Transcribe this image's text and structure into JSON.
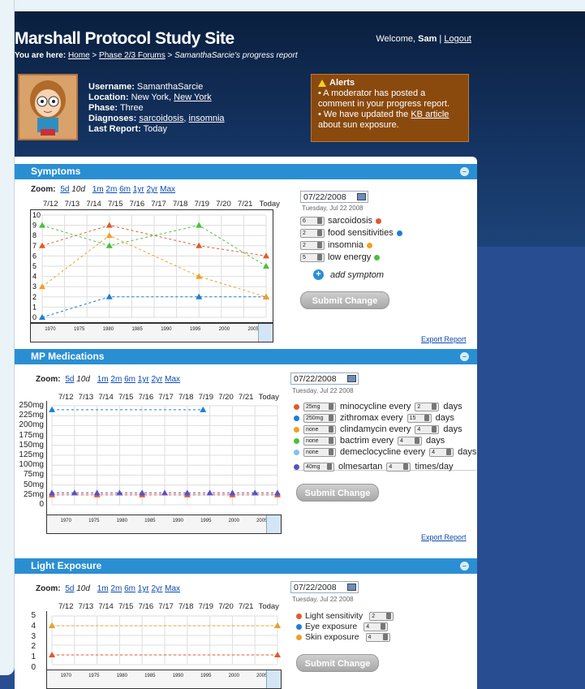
{
  "site": {
    "title": "Marshall Protocol Study Site",
    "welcome_prefix": "Welcome, ",
    "user": "Sam",
    "separator": " | ",
    "logout": "Logout"
  },
  "breadcrumb": {
    "label": "You are here:",
    "home": "Home",
    "sep": " > ",
    "forums": "Phase 2/3 Forums",
    "current": "SamanthaSarcie's progress report"
  },
  "profile": {
    "username_label": "Username:",
    "username": "SamanthaSarcie",
    "location_label": "Location:",
    "location_city": "New York,",
    "location_state": "New York",
    "phase_label": "Phase:",
    "phase": "Three",
    "diagnoses_label": "Diagnoses:",
    "diagnosis1": "sarcoidosis",
    "diagnosis_sep": ",",
    "diagnosis2": "insomnia",
    "last_label": "Last Report:",
    "last": "Today"
  },
  "alerts": {
    "title": "Alerts",
    "line1": "• A moderator has posted a comment in your progress report.",
    "line2_pre": "•  We have updated the ",
    "line2_link": "KB article",
    "line2_post": " about sun exposure."
  },
  "zoom": {
    "label": "Zoom:",
    "options": [
      "5d",
      "10d",
      "1m",
      "2m",
      "6m",
      "1yr",
      "2yr",
      "Max"
    ],
    "selected": "10d"
  },
  "days": [
    "7/12",
    "7/13",
    "7/14",
    "7/15",
    "7/16",
    "7/17",
    "7/18",
    "7/19",
    "7/20",
    "7/21",
    "Today"
  ],
  "timeline_years": [
    "1970",
    "1975",
    "1980",
    "1985",
    "1990",
    "1995",
    "2000",
    "2005"
  ],
  "symptoms": {
    "header": "Symptoms",
    "date": "07/22/2008",
    "date_sub": "Tuesday, Jul 22 2008",
    "items": [
      {
        "value": "6",
        "name": "sarcoidosis",
        "color": "#e05a2b"
      },
      {
        "value": "2",
        "name": "food sensitivities",
        "color": "#1a7fd6"
      },
      {
        "value": "2",
        "name": "insomnia",
        "color": "#f0a020"
      },
      {
        "value": "5",
        "name": "low energy",
        "color": "#4bbf3c"
      }
    ],
    "add": "add symptom",
    "submit": "Submit Change",
    "export": "Export Report",
    "y_ticks": [
      "10",
      "9",
      "8",
      "7",
      "6",
      "5",
      "4",
      "3",
      "2",
      "1",
      "0"
    ]
  },
  "medications": {
    "header": "MP Medications",
    "date": "07/22/2008",
    "date_sub": "Tuesday, Jul 22 2008",
    "items": [
      {
        "dose": "25mg",
        "name": "minocycline every",
        "freq": "2",
        "unit": "days",
        "color": "#e05a2b"
      },
      {
        "dose": "250mg",
        "name": "zithromax every",
        "freq": "15",
        "unit": "days",
        "color": "#1a7fd6"
      },
      {
        "dose": "none",
        "name": "clindamycin every",
        "freq": "4",
        "unit": "days",
        "color": "#f0a020"
      },
      {
        "dose": "none",
        "name": "bactrim every",
        "freq": "4",
        "unit": "days",
        "color": "#4bbf3c"
      },
      {
        "dose": "none",
        "name": "demeclocycline every",
        "freq": "4",
        "unit": "days",
        "color": "#7ec4ee"
      }
    ],
    "olmesartan": {
      "dose": "40mg",
      "name": "olmesartan",
      "freq": "4",
      "unit": "times/day",
      "color": "#5a52c0"
    },
    "submit": "Submit Change",
    "export": "Export Report",
    "y_ticks": [
      "250mg",
      "225mg",
      "200mg",
      "175mg",
      "150mg",
      "125mg",
      "100mg",
      "75mg",
      "50mg",
      "25mg",
      "0"
    ]
  },
  "light": {
    "header": "Light Exposure",
    "date": "07/22/2008",
    "date_sub": "Tuesday, Jul 22 2008",
    "items": [
      {
        "name": "Light sensitivity",
        "value": "2",
        "color": "#e05a2b"
      },
      {
        "name": "Eye exposure",
        "value": "4",
        "color": "#1a7fd6"
      },
      {
        "name": "Skin exposure",
        "value": "4",
        "color": "#f0a020"
      }
    ],
    "submit": "Submit Change",
    "y_ticks": [
      "5",
      "4",
      "3",
      "2",
      "1",
      "0"
    ]
  },
  "chart_data": [
    {
      "type": "line",
      "title": "",
      "categories": [
        "7/12",
        "7/13",
        "7/14",
        "7/15",
        "7/16",
        "7/17",
        "7/18",
        "7/19",
        "7/20",
        "7/21",
        "Today"
      ],
      "ylim": [
        0,
        10
      ],
      "series": [
        {
          "name": "sarcoidosis",
          "color": "#e05a2b",
          "points": [
            [
              0,
              7
            ],
            [
              3,
              9
            ],
            [
              7,
              7
            ],
            [
              10,
              6
            ]
          ]
        },
        {
          "name": "food sensitivities",
          "color": "#1a7fd6",
          "points": [
            [
              0,
              0
            ],
            [
              3,
              2
            ],
            [
              7,
              2
            ],
            [
              10,
              2
            ]
          ]
        },
        {
          "name": "insomnia",
          "color": "#f0a020",
          "points": [
            [
              0,
              3
            ],
            [
              3,
              8
            ],
            [
              7,
              4
            ],
            [
              10,
              2
            ]
          ]
        },
        {
          "name": "low energy",
          "color": "#4bbf3c",
          "points": [
            [
              0,
              9
            ],
            [
              3,
              7
            ],
            [
              7,
              9
            ],
            [
              10,
              5
            ]
          ]
        }
      ]
    },
    {
      "type": "line",
      "title": "",
      "categories": [
        "7/12",
        "7/13",
        "7/14",
        "7/15",
        "7/16",
        "7/17",
        "7/18",
        "7/19",
        "7/20",
        "7/21",
        "Today"
      ],
      "ylim": [
        0,
        250
      ],
      "series": [
        {
          "name": "minocycline",
          "color": "#e05a2b",
          "points": [
            [
              0,
              25
            ],
            [
              2,
              25
            ],
            [
              4,
              25
            ],
            [
              6,
              25
            ],
            [
              8,
              25
            ],
            [
              10,
              25
            ]
          ]
        },
        {
          "name": "zithromax",
          "color": "#1a7fd6",
          "points": [
            [
              0,
              240
            ],
            [
              6.7,
              240
            ]
          ]
        },
        {
          "name": "olmesartan",
          "color": "#5a52c0",
          "points": [
            [
              0,
              30
            ],
            [
              1,
              30
            ],
            [
              2,
              30
            ],
            [
              3,
              30
            ],
            [
              4,
              30
            ],
            [
              5,
              30
            ],
            [
              6,
              30
            ],
            [
              7,
              30
            ],
            [
              8,
              30
            ],
            [
              9,
              30
            ],
            [
              10,
              30
            ]
          ]
        }
      ]
    },
    {
      "type": "line",
      "title": "",
      "categories": [
        "7/12",
        "7/13",
        "7/14",
        "7/15",
        "7/16",
        "7/17",
        "7/18",
        "7/19",
        "7/20",
        "7/21",
        "Today"
      ],
      "ylim": [
        0,
        5
      ],
      "series": [
        {
          "name": "Light sensitivity",
          "color": "#e05a2b",
          "points": [
            [
              0,
              1
            ],
            [
              10,
              1
            ]
          ]
        },
        {
          "name": "Eye exposure",
          "color": "#1a7fd6",
          "points": [
            [
              0,
              4
            ],
            [
              10,
              4
            ]
          ]
        },
        {
          "name": "Skin exposure",
          "color": "#f0a020",
          "points": [
            [
              0,
              4
            ],
            [
              10,
              4
            ]
          ]
        }
      ]
    }
  ]
}
